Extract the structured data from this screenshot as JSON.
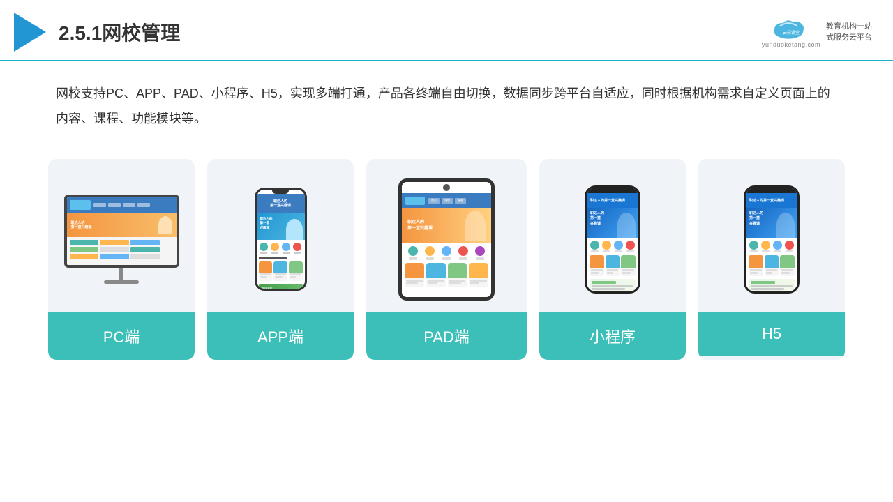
{
  "header": {
    "title": "2.5.1网校管理",
    "brand_name": "云朵课堂",
    "brand_domain": "yunduoketang.com",
    "brand_tagline": "教育机构一站\n式服务云平台"
  },
  "description": {
    "text": "网校支持PC、APP、PAD、小程序、H5，实现多端打通，产品各终端自由切换，数据同步跨平台自适应，同时根据机构需求自定义页面上的内容、课程、功能模块等。"
  },
  "cards": [
    {
      "id": "pc",
      "label": "PC端"
    },
    {
      "id": "app",
      "label": "APP端"
    },
    {
      "id": "pad",
      "label": "PAD端"
    },
    {
      "id": "miniprogram",
      "label": "小程序"
    },
    {
      "id": "h5",
      "label": "H5"
    }
  ],
  "colors": {
    "accent": "#3bbfb8",
    "header_line": "#1ab3c8",
    "title": "#333333",
    "text": "#333333",
    "card_bg": "#f0f4f8",
    "label_bg": "#3bbfb8"
  },
  "icons": {
    "phone_icon1_color": "#4db6ac",
    "phone_icon2_color": "#ffb74d",
    "phone_icon3_color": "#64b5f6",
    "phone_icon4_color": "#ef5350",
    "phone_card1_color": "#f59540",
    "phone_card2_color": "#4db6e0",
    "phone_card3_color": "#81c784",
    "phone_card4_color": "#ffb74d"
  }
}
